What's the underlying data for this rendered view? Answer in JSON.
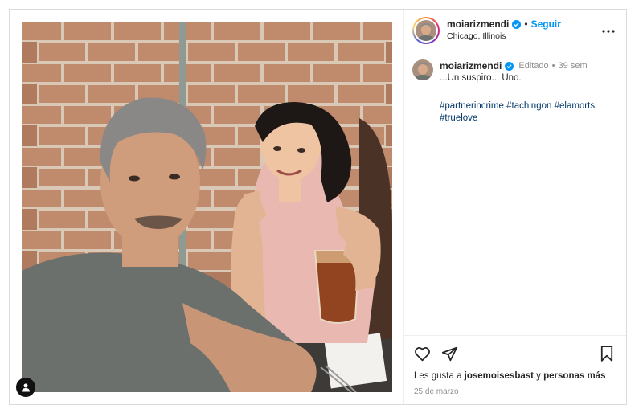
{
  "header": {
    "username": "moiarizmendi",
    "dot": "•",
    "follow_label": "Seguir",
    "location": "Chicago, Illinois",
    "more_label": "•••"
  },
  "caption": {
    "username": "moiarizmendi",
    "edited": "Editado",
    "dot": "•",
    "time_ago": "39 sem",
    "text": "...Un suspiro... Uno.",
    "hashtags": [
      "#partnerincrime",
      "#tachingon",
      "#elamorts",
      "#truelove"
    ]
  },
  "actions": {
    "likes_prefix": "Les gusta a",
    "likes_user": "josemoisesbast",
    "likes_middle": "y",
    "likes_suffix": "personas más",
    "date": "25 de marzo"
  },
  "colors": {
    "accent": "#0095f6",
    "hashtag": "#00376b",
    "muted": "#8e8e8e",
    "verified": "#0095f6"
  },
  "icons": [
    "verified-badge-icon",
    "more-options-icon",
    "heart-icon",
    "share-icon",
    "bookmark-icon",
    "tag-people-icon"
  ]
}
